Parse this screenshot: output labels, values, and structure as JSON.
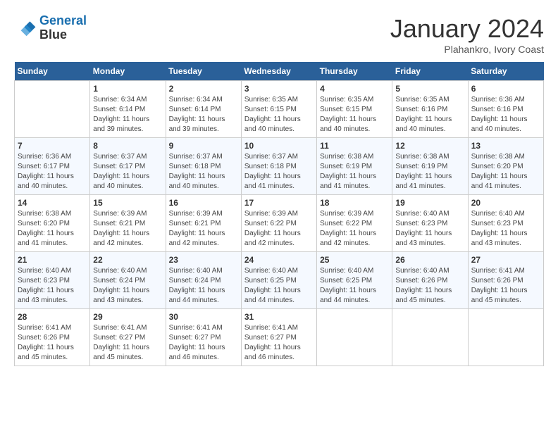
{
  "header": {
    "logo_line1": "General",
    "logo_line2": "Blue",
    "title": "January 2024",
    "subtitle": "Plahankro, Ivory Coast"
  },
  "calendar": {
    "days_of_week": [
      "Sunday",
      "Monday",
      "Tuesday",
      "Wednesday",
      "Thursday",
      "Friday",
      "Saturday"
    ],
    "weeks": [
      [
        {
          "day": "",
          "info": ""
        },
        {
          "day": "1",
          "info": "Sunrise: 6:34 AM\nSunset: 6:14 PM\nDaylight: 11 hours\nand 39 minutes."
        },
        {
          "day": "2",
          "info": "Sunrise: 6:34 AM\nSunset: 6:14 PM\nDaylight: 11 hours\nand 39 minutes."
        },
        {
          "day": "3",
          "info": "Sunrise: 6:35 AM\nSunset: 6:15 PM\nDaylight: 11 hours\nand 40 minutes."
        },
        {
          "day": "4",
          "info": "Sunrise: 6:35 AM\nSunset: 6:15 PM\nDaylight: 11 hours\nand 40 minutes."
        },
        {
          "day": "5",
          "info": "Sunrise: 6:35 AM\nSunset: 6:16 PM\nDaylight: 11 hours\nand 40 minutes."
        },
        {
          "day": "6",
          "info": "Sunrise: 6:36 AM\nSunset: 6:16 PM\nDaylight: 11 hours\nand 40 minutes."
        }
      ],
      [
        {
          "day": "7",
          "info": "Sunrise: 6:36 AM\nSunset: 6:17 PM\nDaylight: 11 hours\nand 40 minutes."
        },
        {
          "day": "8",
          "info": "Sunrise: 6:37 AM\nSunset: 6:17 PM\nDaylight: 11 hours\nand 40 minutes."
        },
        {
          "day": "9",
          "info": "Sunrise: 6:37 AM\nSunset: 6:18 PM\nDaylight: 11 hours\nand 40 minutes."
        },
        {
          "day": "10",
          "info": "Sunrise: 6:37 AM\nSunset: 6:18 PM\nDaylight: 11 hours\nand 41 minutes."
        },
        {
          "day": "11",
          "info": "Sunrise: 6:38 AM\nSunset: 6:19 PM\nDaylight: 11 hours\nand 41 minutes."
        },
        {
          "day": "12",
          "info": "Sunrise: 6:38 AM\nSunset: 6:19 PM\nDaylight: 11 hours\nand 41 minutes."
        },
        {
          "day": "13",
          "info": "Sunrise: 6:38 AM\nSunset: 6:20 PM\nDaylight: 11 hours\nand 41 minutes."
        }
      ],
      [
        {
          "day": "14",
          "info": "Sunrise: 6:38 AM\nSunset: 6:20 PM\nDaylight: 11 hours\nand 41 minutes."
        },
        {
          "day": "15",
          "info": "Sunrise: 6:39 AM\nSunset: 6:21 PM\nDaylight: 11 hours\nand 42 minutes."
        },
        {
          "day": "16",
          "info": "Sunrise: 6:39 AM\nSunset: 6:21 PM\nDaylight: 11 hours\nand 42 minutes."
        },
        {
          "day": "17",
          "info": "Sunrise: 6:39 AM\nSunset: 6:22 PM\nDaylight: 11 hours\nand 42 minutes."
        },
        {
          "day": "18",
          "info": "Sunrise: 6:39 AM\nSunset: 6:22 PM\nDaylight: 11 hours\nand 42 minutes."
        },
        {
          "day": "19",
          "info": "Sunrise: 6:40 AM\nSunset: 6:23 PM\nDaylight: 11 hours\nand 43 minutes."
        },
        {
          "day": "20",
          "info": "Sunrise: 6:40 AM\nSunset: 6:23 PM\nDaylight: 11 hours\nand 43 minutes."
        }
      ],
      [
        {
          "day": "21",
          "info": "Sunrise: 6:40 AM\nSunset: 6:23 PM\nDaylight: 11 hours\nand 43 minutes."
        },
        {
          "day": "22",
          "info": "Sunrise: 6:40 AM\nSunset: 6:24 PM\nDaylight: 11 hours\nand 43 minutes."
        },
        {
          "day": "23",
          "info": "Sunrise: 6:40 AM\nSunset: 6:24 PM\nDaylight: 11 hours\nand 44 minutes."
        },
        {
          "day": "24",
          "info": "Sunrise: 6:40 AM\nSunset: 6:25 PM\nDaylight: 11 hours\nand 44 minutes."
        },
        {
          "day": "25",
          "info": "Sunrise: 6:40 AM\nSunset: 6:25 PM\nDaylight: 11 hours\nand 44 minutes."
        },
        {
          "day": "26",
          "info": "Sunrise: 6:40 AM\nSunset: 6:26 PM\nDaylight: 11 hours\nand 45 minutes."
        },
        {
          "day": "27",
          "info": "Sunrise: 6:41 AM\nSunset: 6:26 PM\nDaylight: 11 hours\nand 45 minutes."
        }
      ],
      [
        {
          "day": "28",
          "info": "Sunrise: 6:41 AM\nSunset: 6:26 PM\nDaylight: 11 hours\nand 45 minutes."
        },
        {
          "day": "29",
          "info": "Sunrise: 6:41 AM\nSunset: 6:27 PM\nDaylight: 11 hours\nand 45 minutes."
        },
        {
          "day": "30",
          "info": "Sunrise: 6:41 AM\nSunset: 6:27 PM\nDaylight: 11 hours\nand 46 minutes."
        },
        {
          "day": "31",
          "info": "Sunrise: 6:41 AM\nSunset: 6:27 PM\nDaylight: 11 hours\nand 46 minutes."
        },
        {
          "day": "",
          "info": ""
        },
        {
          "day": "",
          "info": ""
        },
        {
          "day": "",
          "info": ""
        }
      ]
    ]
  }
}
